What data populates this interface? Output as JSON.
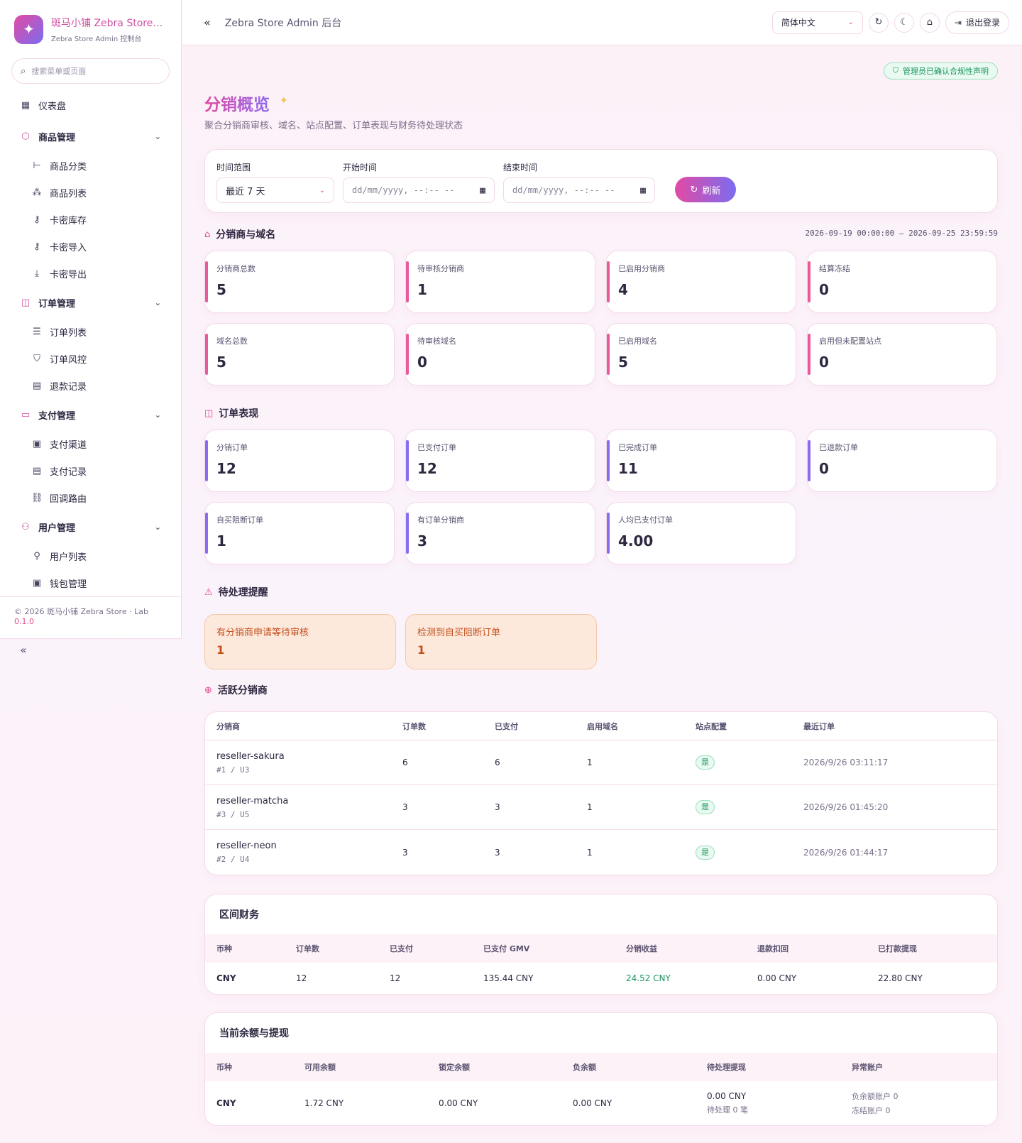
{
  "brand": {
    "title": "斑马小铺 Zebra Store Admin",
    "subtitle": "Zebra Store Admin 控制台"
  },
  "search": {
    "placeholder": "搜索菜单或页面"
  },
  "nav": {
    "dashboard": "仪表盘",
    "groups": [
      {
        "label": "商品管理",
        "items": [
          "商品分类",
          "商品列表",
          "卡密库存",
          "卡密导入",
          "卡密导出"
        ]
      },
      {
        "label": "订单管理",
        "items": [
          "订单列表",
          "订单风控",
          "退款记录"
        ]
      },
      {
        "label": "支付管理",
        "items": [
          "支付渠道",
          "支付记录",
          "回调路由"
        ]
      },
      {
        "label": "用户管理",
        "items": [
          "用户列表",
          "钱包管理"
        ]
      }
    ]
  },
  "footer": {
    "copyright": "© 2026 斑马小铺 Zebra Store · Lab",
    "version": "0.1.0"
  },
  "header": {
    "title": "Zebra Store Admin 后台",
    "language": "简体中文",
    "logout": "退出登录"
  },
  "compliance": "管理员已确认合规性声明",
  "page": {
    "title": "分销概览",
    "subtitle": "聚合分销商审核、域名、站点配置、订单表现与财务待处理状态"
  },
  "filter": {
    "range_label": "时间范围",
    "range_value": "最近 7 天",
    "start_label": "开始时间",
    "start_placeholder": "dd/mm/yyyy, --:-- --",
    "end_label": "结束时间",
    "end_placeholder": "dd/mm/yyyy, --:-- --",
    "refresh": "刷新"
  },
  "reseller_section": {
    "title": "分销商与域名",
    "range": "2026-09-19 00:00:00 – 2026-09-25 23:59:59",
    "cards": [
      {
        "label": "分销商总数",
        "value": "5"
      },
      {
        "label": "待审核分销商",
        "value": "1"
      },
      {
        "label": "已启用分销商",
        "value": "4"
      },
      {
        "label": "结算冻结",
        "value": "0"
      },
      {
        "label": "域名总数",
        "value": "5"
      },
      {
        "label": "待审核域名",
        "value": "0"
      },
      {
        "label": "已启用域名",
        "value": "5"
      },
      {
        "label": "启用但未配置站点",
        "value": "0"
      }
    ]
  },
  "order_section": {
    "title": "订单表现",
    "cards": [
      {
        "label": "分销订单",
        "value": "12"
      },
      {
        "label": "已支付订单",
        "value": "12"
      },
      {
        "label": "已完成订单",
        "value": "11"
      },
      {
        "label": "已退款订单",
        "value": "0"
      },
      {
        "label": "自买阻断订单",
        "value": "1"
      },
      {
        "label": "有订单分销商",
        "value": "3"
      },
      {
        "label": "人均已支付订单",
        "value": "4.00"
      }
    ]
  },
  "pending_section": {
    "title": "待处理提醒",
    "alerts": [
      {
        "label": "有分销商申请等待审核",
        "value": "1"
      },
      {
        "label": "检测到自买阻断订单",
        "value": "1"
      }
    ]
  },
  "active_section": {
    "title": "活跃分销商",
    "columns": [
      "分销商",
      "订单数",
      "已支付",
      "启用域名",
      "站点配置",
      "最近订单"
    ],
    "rows": [
      {
        "name": "reseller-sakura",
        "meta": "#1 / U3",
        "orders": "6",
        "paid": "6",
        "domains": "1",
        "site": "是",
        "last": "2026/9/26 03:11:17"
      },
      {
        "name": "reseller-matcha",
        "meta": "#3 / U5",
        "orders": "3",
        "paid": "3",
        "domains": "1",
        "site": "是",
        "last": "2026/9/26 01:45:20"
      },
      {
        "name": "reseller-neon",
        "meta": "#2 / U4",
        "orders": "3",
        "paid": "3",
        "domains": "1",
        "site": "是",
        "last": "2026/9/26 01:44:17"
      }
    ]
  },
  "finance": {
    "title": "区间财务",
    "columns": [
      "币种",
      "订单数",
      "已支付",
      "已支付 GMV",
      "分销收益",
      "退款扣回",
      "已打款提现"
    ],
    "row": {
      "currency": "CNY",
      "orders": "12",
      "paid": "12",
      "gmv": "135.44 CNY",
      "earnings": "24.52 CNY",
      "refund": "0.00 CNY",
      "withdrawn": "22.80 CNY"
    }
  },
  "balance": {
    "title": "当前余额与提现",
    "columns": [
      "币种",
      "可用余额",
      "锁定余额",
      "负余额",
      "待处理提现",
      "异常账户"
    ],
    "row": {
      "currency": "CNY",
      "available": "1.72 CNY",
      "locked": "0.00 CNY",
      "negative": "0.00 CNY",
      "pending": "0.00 CNY",
      "pending_count": "待处理 0 笔",
      "neg_accounts": "负余额账户 0",
      "frozen_accounts": "冻结账户 0"
    }
  },
  "colors": {
    "accent": "#e24aa4",
    "accent2": "#7c6cf0",
    "success": "#17945b",
    "warning": "#c4501c"
  }
}
